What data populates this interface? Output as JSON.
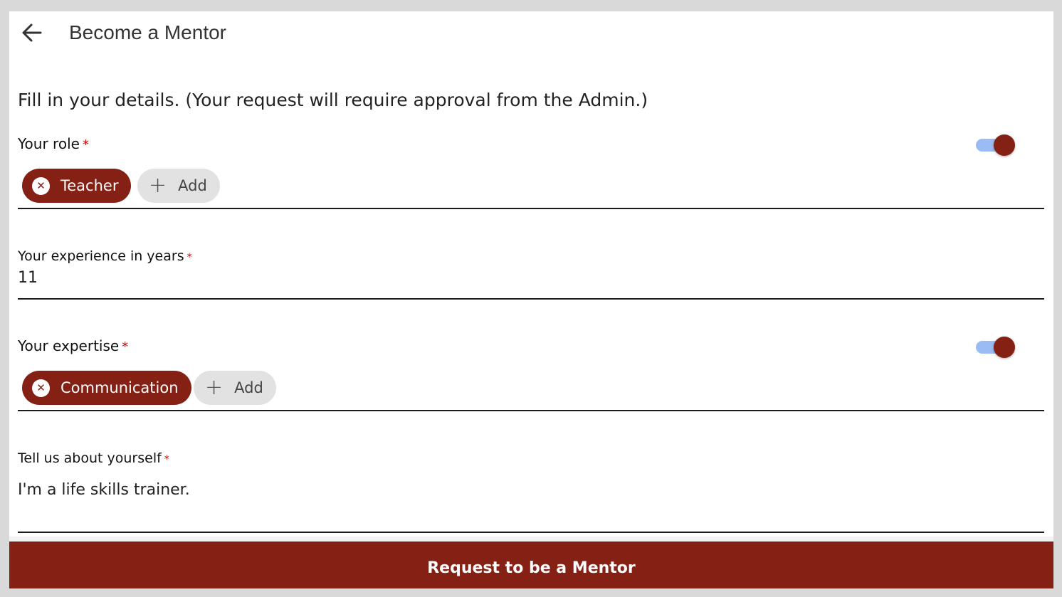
{
  "header": {
    "back_icon": "arrow-left-icon",
    "title": "Become a Mentor"
  },
  "intro": "Fill in your details. (Your request will require approval from the Admin.)",
  "role": {
    "label": "Your role",
    "required_mark": "*",
    "toggle_on": true,
    "chips": [
      "Teacher"
    ],
    "add_label": "Add"
  },
  "experience": {
    "label": "Your experience in years",
    "required_mark": "*",
    "value": "11"
  },
  "expertise": {
    "label": "Your expertise",
    "required_mark": "*",
    "toggle_on": true,
    "chips": [
      "Communication"
    ],
    "add_label": "Add"
  },
  "about": {
    "label": "Tell us about yourself",
    "required_mark": "*",
    "value": "I'm a life skills trainer."
  },
  "submit_label": "Request to be a Mentor",
  "colors": {
    "accent": "#852015",
    "toggle_track": "#9bbbf5",
    "required": "#d00000",
    "chip_add_bg": "#e2e2e2"
  }
}
